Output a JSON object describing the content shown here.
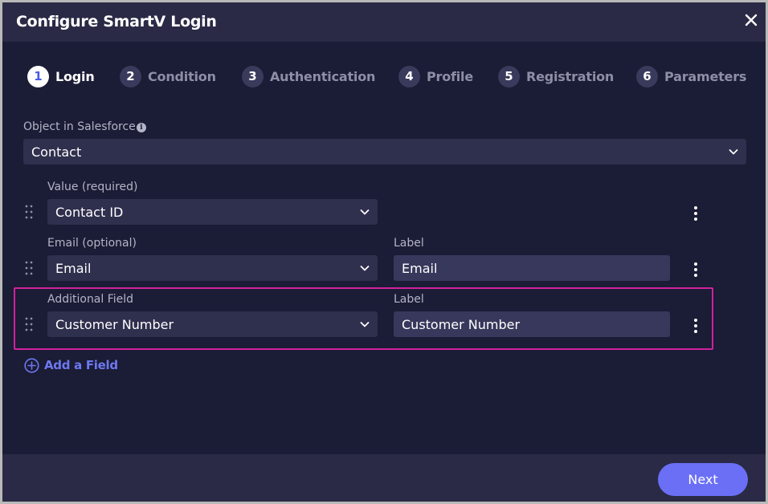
{
  "dialog": {
    "title": "Configure SmartV Login",
    "close_icon": "close-icon"
  },
  "steps": [
    {
      "number": "1",
      "label": "Login",
      "active": true
    },
    {
      "number": "2",
      "label": "Condition",
      "active": false
    },
    {
      "number": "3",
      "label": "Authentication",
      "active": false
    },
    {
      "number": "4",
      "label": "Profile",
      "active": false
    },
    {
      "number": "5",
      "label": "Registration",
      "active": false
    },
    {
      "number": "6",
      "label": "Parameters",
      "active": false
    }
  ],
  "object": {
    "label": "Object in Salesforce",
    "info_glyph": "i",
    "value": "Contact"
  },
  "fields": [
    {
      "field_label": "Value (required)",
      "field_value": "Contact ID",
      "label_label": "",
      "label_value": ""
    },
    {
      "field_label": "Email (optional)",
      "field_value": "Email",
      "label_label": "Label",
      "label_value": "Email"
    },
    {
      "field_label": "Additional Field",
      "field_value": "Customer Number",
      "label_label": "Label",
      "label_value": "Customer Number"
    }
  ],
  "add_field": {
    "label": "Add a Field"
  },
  "footer": {
    "next_label": "Next"
  },
  "colors": {
    "accent": "#6b6ff6",
    "highlight": "#d0229e",
    "background": "#1b1c35",
    "header": "#2a2a46"
  }
}
